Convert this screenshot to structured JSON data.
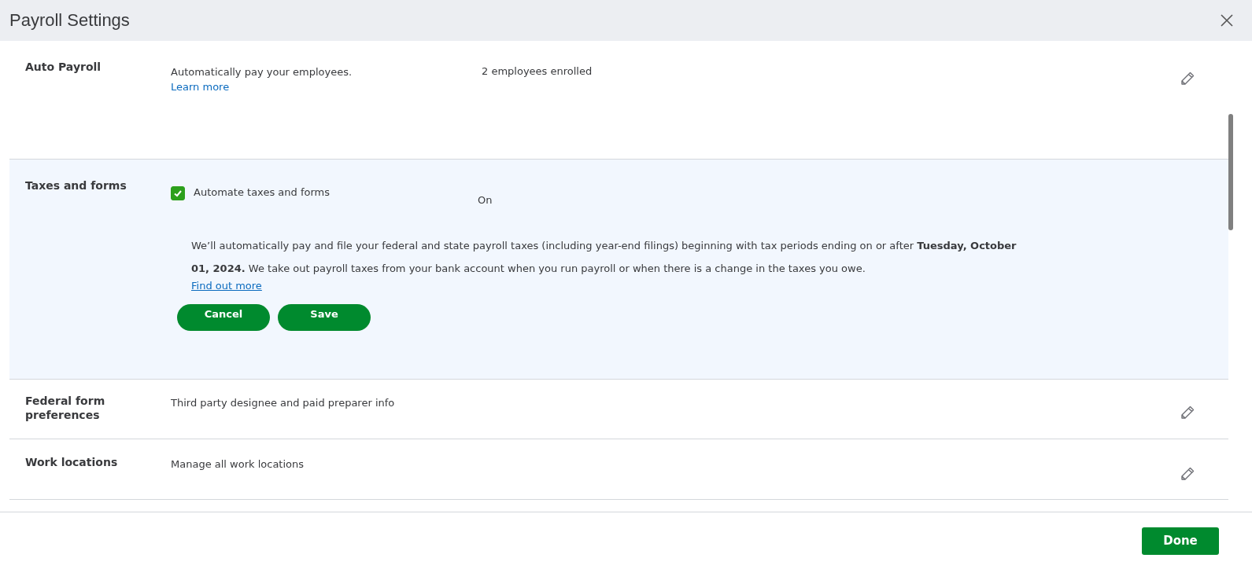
{
  "dialog": {
    "title": "Payroll Settings"
  },
  "sections": [
    {
      "title": "Auto Payroll",
      "expanded": false,
      "description": "Automatically pay your employees.",
      "link": "Learn more",
      "value": "2 employees enrolled"
    },
    {
      "title": "Taxes and forms",
      "expanded": true,
      "checkbox": {
        "label": "Automate taxes and forms",
        "checked": true
      },
      "value": "On",
      "paragraph": "We’ll automatically pay and file your federal and state payroll taxes (including year-end filings) beginning with tax periods ending on or after **Tuesday, October 01, 2024.** We take out payroll taxes from your bank account when you run payroll or when there is a change in the taxes you owe.",
      "link": "Find out more",
      "buttons": [
        "Cancel",
        "Save"
      ]
    },
    {
      "title": "Federal form preferences",
      "expanded": false,
      "description": "Third party designee and paid preparer info"
    },
    {
      "title": "Work locations",
      "expanded": false,
      "description": "Manage all work locations"
    }
  ],
  "footer": {
    "button": "Done"
  }
}
